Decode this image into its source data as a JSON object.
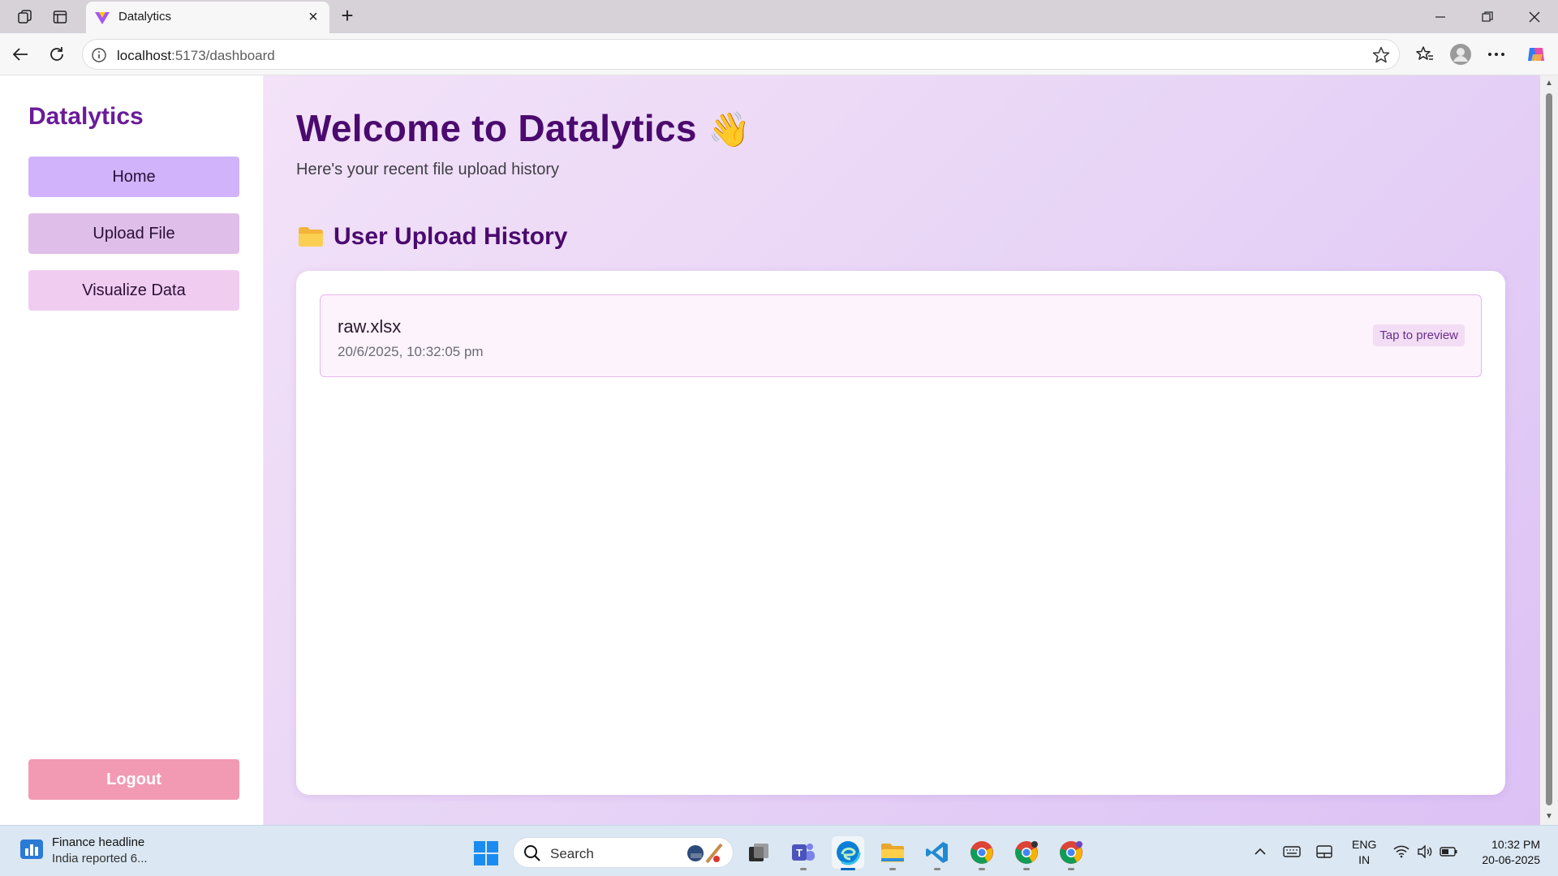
{
  "browser": {
    "tab_title": "Datalytics",
    "url_host": "localhost",
    "url_rest": ":5173/dashboard"
  },
  "sidebar": {
    "brand": "Datalytics",
    "items": [
      {
        "label": "Home"
      },
      {
        "label": "Upload File"
      },
      {
        "label": "Visualize Data"
      }
    ],
    "logout_label": "Logout"
  },
  "main": {
    "welcome": "Welcome to Datalytics",
    "welcome_emoji": "👋",
    "subtitle": "Here's your recent file upload history",
    "section_title": "User Upload History",
    "uploads": [
      {
        "name": "raw.xlsx",
        "date": "20/6/2025, 10:32:05 pm",
        "action": "Tap to preview"
      }
    ]
  },
  "taskbar": {
    "widget_title": "Finance headline",
    "widget_sub": "India reported 6...",
    "search_placeholder": "Search",
    "lang_line1": "ENG",
    "lang_line2": "IN",
    "time": "10:32 PM",
    "date": "20-06-2025"
  },
  "colors": {
    "brand": "#6b1b9a",
    "home_btn": "#d0b3fb",
    "upload_btn": "#dfbee9",
    "visual_btn": "#f1ccf1",
    "logout_btn": "#f29ab4"
  }
}
